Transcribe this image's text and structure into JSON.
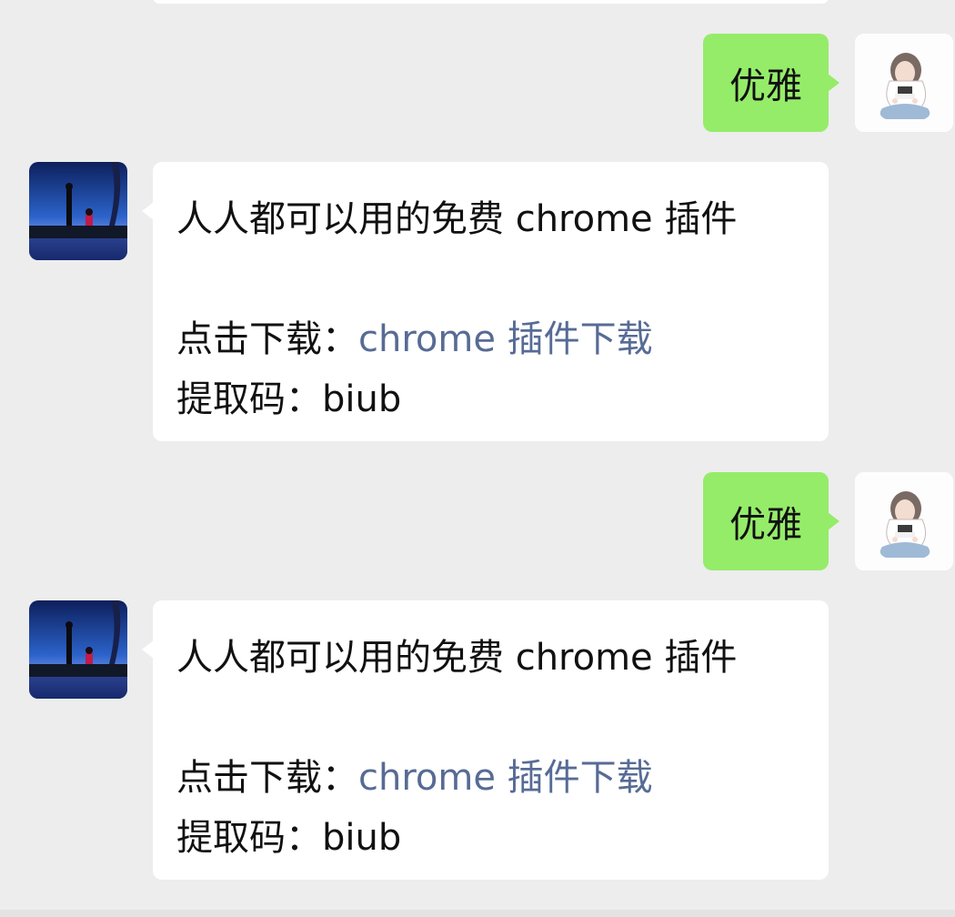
{
  "messages": [
    {
      "side": "right",
      "type": "sent",
      "text": "优雅"
    },
    {
      "side": "left",
      "type": "received",
      "line1": "人人都可以用的免费 chrome 插件",
      "download_label": "点击下载：",
      "download_link": "chrome 插件下载",
      "code_label": "提取码：",
      "code_value": "biub"
    },
    {
      "side": "right",
      "type": "sent",
      "text": "优雅"
    },
    {
      "side": "left",
      "type": "received",
      "line1": "人人都可以用的免费 chrome 插件",
      "download_label": "点击下载：",
      "download_link": "chrome 插件下载",
      "code_label": "提取码：",
      "code_value": "biub"
    }
  ],
  "colors": {
    "background": "#ededed",
    "sent_bubble": "#95ec69",
    "received_bubble": "#ffffff",
    "link": "#576b95"
  },
  "icons": {
    "left_avatar": "night-sky-silhouette-avatar",
    "right_avatar": "sketch-girl-avatar"
  }
}
